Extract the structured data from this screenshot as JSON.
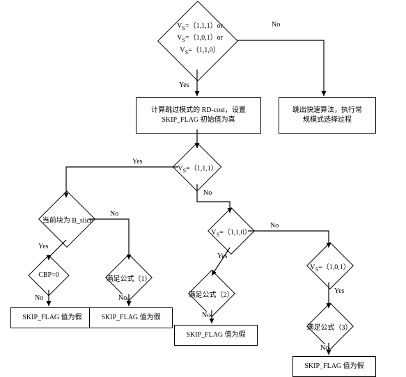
{
  "d1": {
    "l1": "V<sub>S</sub>=（1,1,1）or",
    "l2": "V<sub>S</sub>=（1,0,1）or",
    "l3": "V<sub>S</sub>=（1,1,0）"
  },
  "r1": {
    "l1": "计算跳过模式的 RD-cost，设置",
    "l2": "SKIP_FLAG 初始值为真"
  },
  "r2": {
    "l1": "跳出快速算法，执行常",
    "l2": "规模式选择过程"
  },
  "d2": "V<sub>S</sub>=（1,1,1）",
  "d3": "当前块为 B_slice",
  "d4": "CBP=0",
  "d5": "满足公式（1）",
  "d6": "V<sub>S</sub>=（1,1,0）",
  "d7": "满足公式（2）",
  "d8": "V<sub>S</sub>=（1,0,1）",
  "d9": "满足公式（3）",
  "r3": "SKIP_FLAG 值为假",
  "r4": "SKIP_FLAG 值为假",
  "r5": "SKIP_FLAG 值为假",
  "r6": "SKIP_FLAG 值为假",
  "yes": "Yes",
  "no": "No"
}
